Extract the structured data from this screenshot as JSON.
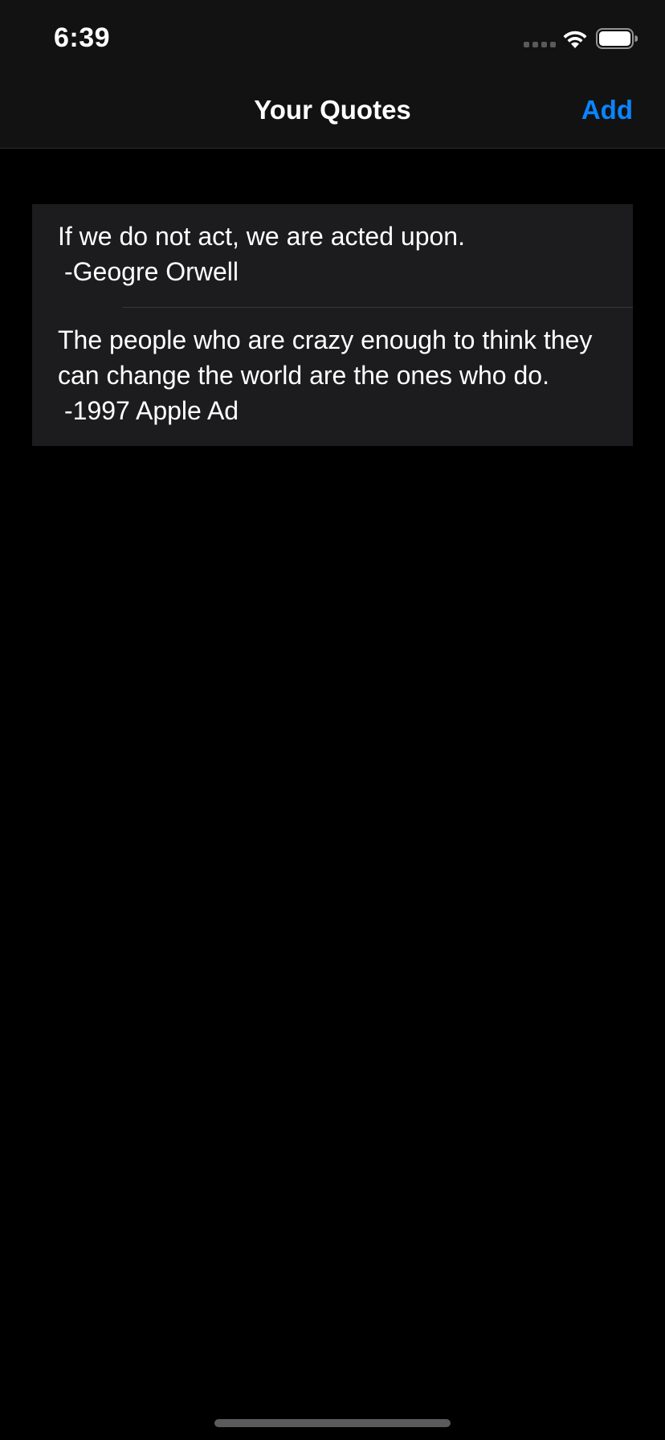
{
  "status_bar": {
    "time": "6:39",
    "signal_icon": "signal-dots-icon",
    "wifi_icon": "wifi-icon",
    "battery_icon": "battery-icon"
  },
  "nav": {
    "title": "Your Quotes",
    "add_label": "Add",
    "accent_color": "#0a84ff"
  },
  "quotes": [
    {
      "text": "If we do not act, we are acted upon.",
      "author": "-Geogre Orwell"
    },
    {
      "text": "The people who are crazy enough to think they can change the world are the ones who do.",
      "author": "-1997 Apple Ad"
    }
  ]
}
